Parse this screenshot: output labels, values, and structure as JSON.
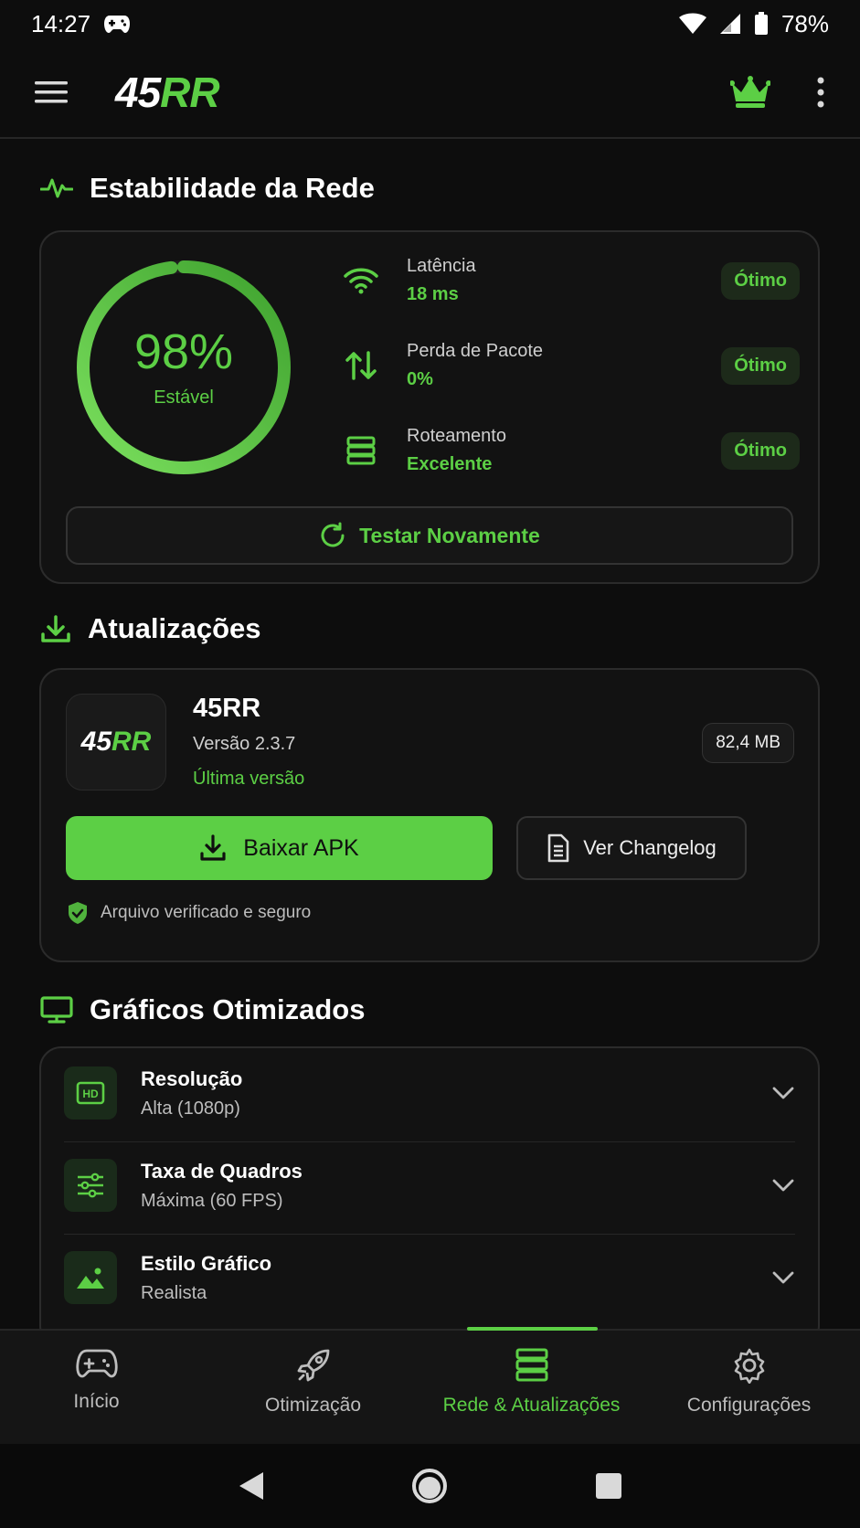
{
  "status": {
    "time": "14:27",
    "battery": "78%"
  },
  "app_bar": {
    "logo_white": "45",
    "logo_green": "RR"
  },
  "network": {
    "section_title": "Estabilidade da Rede",
    "stability_percent": "98%",
    "stability_value": 0.98,
    "stability_label": "Estável",
    "metrics": [
      {
        "icon": "wifi-icon",
        "label": "Latência",
        "value": "18 ms",
        "badge": "Ótimo"
      },
      {
        "icon": "arrows-up-down-icon",
        "label": "Perda de Pacote",
        "value": "0%",
        "badge": "Ótimo"
      },
      {
        "icon": "server-icon",
        "label": "Roteamento",
        "value": "Excelente",
        "badge": "Ótimo"
      }
    ],
    "retest_label": "Testar Novamente"
  },
  "updates": {
    "section_title": "Atualizações",
    "app_name": "45RR",
    "version": "Versão 2.3.7",
    "latest": "Última versão",
    "size": "82,4 MB",
    "download_label": "Baixar APK",
    "changelog_label": "Ver Changelog",
    "verified": "Arquivo verificado e seguro"
  },
  "graphics": {
    "section_title": "Gráficos Otimizados",
    "items": [
      {
        "icon": "hd-icon",
        "title": "Resolução",
        "value": "Alta (1080p)"
      },
      {
        "icon": "sliders-icon",
        "title": "Taxa de Quadros",
        "value": "Máxima (60 FPS)"
      },
      {
        "icon": "image-icon",
        "title": "Estilo Gráfico",
        "value": "Realista"
      }
    ]
  },
  "bottom_nav": {
    "items": [
      {
        "label": "Início",
        "icon": "gamepad-icon"
      },
      {
        "label": "Otimização",
        "icon": "rocket-icon"
      },
      {
        "label": "Rede & Atualizações",
        "icon": "server-icon",
        "active": true
      },
      {
        "label": "Configurações",
        "icon": "gear-icon"
      }
    ]
  },
  "colors": {
    "accent": "#5ccf45",
    "background": "#0d0d0d",
    "card": "#121212"
  }
}
